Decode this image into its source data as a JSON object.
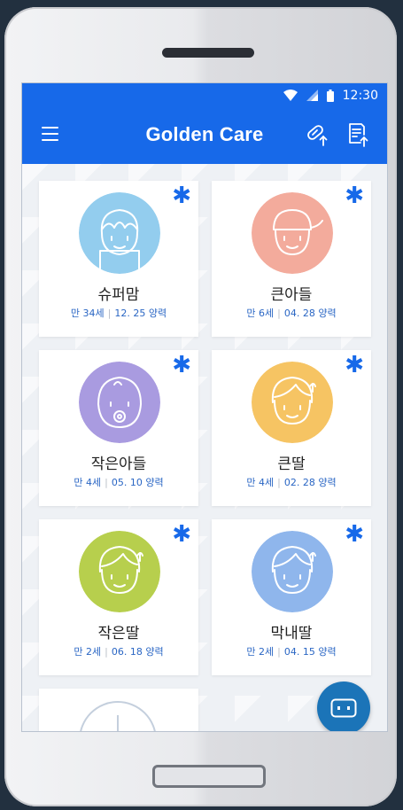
{
  "status_bar": {
    "time": "12:30"
  },
  "app_bar": {
    "title": "Golden Care"
  },
  "colors": {
    "primary": "#1769e9",
    "supermom": "#93cdee",
    "big_son": "#f3ab9c",
    "small_son": "#a99be0",
    "big_daughter": "#f6c463",
    "small_daughter": "#b7cf4d",
    "youngest_daughter": "#8fb6ec"
  },
  "profiles": [
    {
      "name": "슈퍼맘",
      "age": "만 34세",
      "date": "12. 25 양력",
      "icon": "mom-face-icon"
    },
    {
      "name": "큰아들",
      "age": "만 6세",
      "date": "04. 28 양력",
      "icon": "boy-cap-face-icon"
    },
    {
      "name": "작은아들",
      "age": "만 4세",
      "date": "05. 10 양력",
      "icon": "baby-pacifier-face-icon"
    },
    {
      "name": "큰딸",
      "age": "만 4세",
      "date": "02. 28 양력",
      "icon": "girl-face-icon"
    },
    {
      "name": "작은딸",
      "age": "만 2세",
      "date": "06. 18 양력",
      "icon": "girl-face-icon"
    },
    {
      "name": "막내딸",
      "age": "만 2세",
      "date": "04. 15 양력",
      "icon": "girl-face-icon"
    }
  ],
  "favorite_mark": "✱",
  "fabs": [
    {
      "icon": "robot-chat-icon"
    },
    {
      "icon": "camera-icon"
    }
  ]
}
